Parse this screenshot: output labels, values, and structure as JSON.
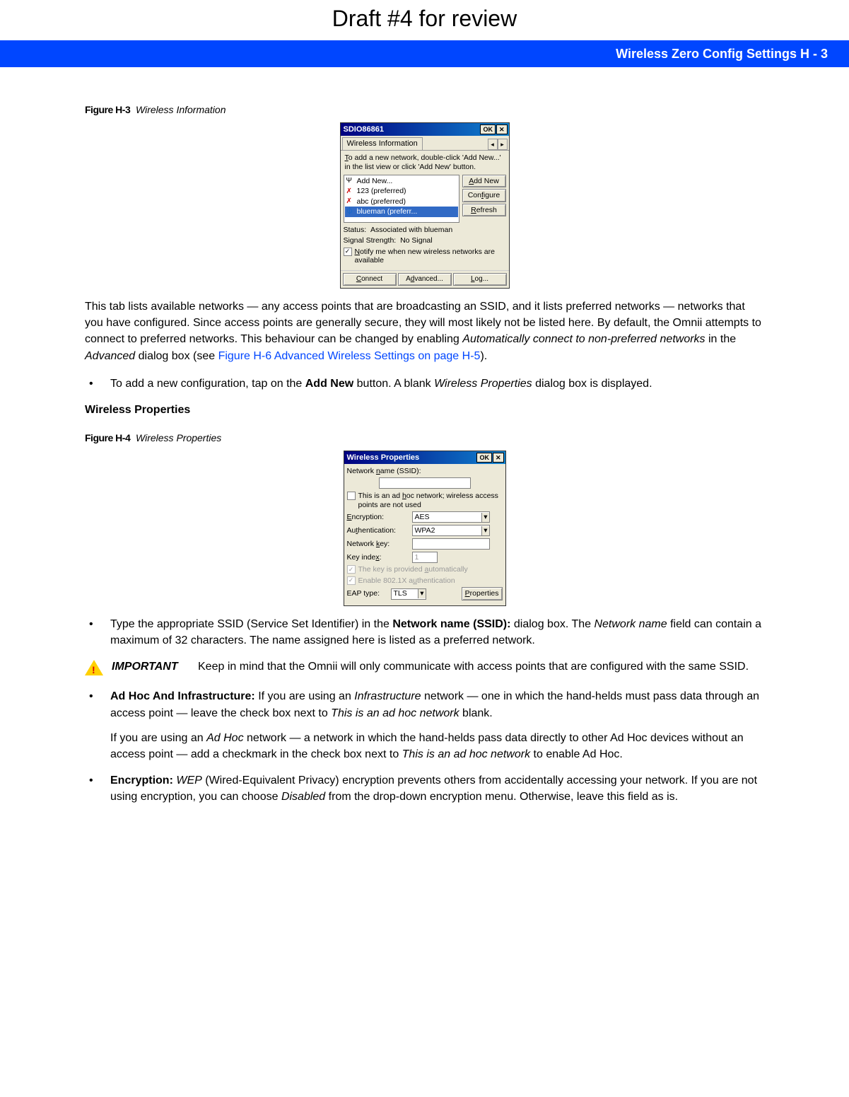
{
  "draft_header": "Draft #4 for review",
  "bluebar": "Wireless Zero Config Settings     H - 3",
  "fig_h3": {
    "label": "Figure H-3",
    "title": "Wireless Information"
  },
  "fig_h4": {
    "label": "Figure H-4",
    "title": "Wireless Properties"
  },
  "win1": {
    "title": "SDIO86861",
    "ok": "OK",
    "tab": "Wireless Information",
    "hint": "To add a new network, double-click 'Add New...' in the list view or click 'Add New' button.",
    "list": [
      "Add New...",
      "123 (preferred)",
      "abc (preferred)",
      "blueman (preferr..."
    ],
    "buttons": {
      "add": "Add New",
      "cfg": "Configure",
      "ref": "Refresh"
    },
    "status_label": "Status:",
    "status_value": "Associated with blueman",
    "signal_label": "Signal Strength:",
    "signal_value": "No Signal",
    "notify_label": "Notify me when new wireless networks are available",
    "bottom": {
      "connect": "Connect",
      "adv": "Advanced...",
      "log": "Log..."
    }
  },
  "win2": {
    "title": "Wireless Properties",
    "ok": "OK",
    "ssid_label": "Network name (SSID):",
    "adhoc_label": "This is an ad hoc network; wireless access points are not used",
    "encryption_label": "Encryption:",
    "encryption_value": "AES",
    "auth_label": "Authentication:",
    "auth_value": "WPA2",
    "key_label": "Network key:",
    "keyindex_label": "Key index:",
    "keyindex_value": "1",
    "autokey_label": "The key is provided automatically",
    "enable8021x_label": "Enable 802.1X authentication",
    "eap_label": "EAP type:",
    "eap_value": "TLS",
    "properties_btn": "Properties"
  },
  "body": {
    "para_intro_a": "This tab lists available networks — any access points that are broadcasting an SSID, and it lists preferred networks — networks that you have configured. Since access points are generally secure, they will most likely not be listed here. By default, the Omnii attempts to connect to preferred networks. This behaviour can be changed by enabling ",
    "para_intro_i1": "Automatically connect to non-preferred networks",
    "para_intro_b": " in the ",
    "para_intro_i2": "Advanced",
    "para_intro_c": " dialog box (see ",
    "para_intro_link": "Figure H-6 Advanced Wireless Settings  on page H-5",
    "para_intro_d": ").",
    "bullet_addnew_a": "To add a new configuration, tap on the ",
    "bullet_addnew_bold": "Add New",
    "bullet_addnew_b": " button. A blank ",
    "bullet_addnew_i": "Wireless Properties",
    "bullet_addnew_c": " dialog box is displayed.",
    "section_wp": "Wireless Properties",
    "bullet_ssid_a": "Type the appropriate SSID (Service Set Identifier) in the ",
    "bullet_ssid_bold": "Network name (SSID):",
    "bullet_ssid_b": " dialog box. The ",
    "bullet_ssid_i": "Network name",
    "bullet_ssid_c": " field can contain a maximum of 32 characters. The name assigned here is listed as a preferred network.",
    "important_label": "IMPORTANT",
    "important_text": "Keep in mind that the Omnii will only communicate with access points that are configured with the same SSID.",
    "bullet_adhoc_bold": "Ad Hoc And Infrastructure: ",
    "bullet_adhoc_a": "If you are using an ",
    "bullet_adhoc_i1": "Infrastructure",
    "bullet_adhoc_b": " network — one in which the hand-helds must pass data through an access point — leave the check box next to ",
    "bullet_adhoc_i2": "This is an ad hoc network",
    "bullet_adhoc_c": " blank.",
    "bullet_adhoc2_a": "If you are using an ",
    "bullet_adhoc2_i1": "Ad Hoc",
    "bullet_adhoc2_b": " network — a network in which the hand-helds pass data directly to other Ad Hoc devices without an access point — add a checkmark in the check box next to ",
    "bullet_adhoc2_i2": "This is an ad hoc network",
    "bullet_adhoc2_c": " to enable Ad Hoc.",
    "bullet_enc_bold": "Encryption: ",
    "bullet_enc_i": "WEP",
    "bullet_enc_a": " (Wired-Equivalent Privacy) encryption prevents others from accidentally accessing your network. If you are not using encryption, you can choose ",
    "bullet_enc_i2": "Disabled",
    "bullet_enc_b": " from the drop-down encryption menu. Otherwise, leave this field as is."
  }
}
